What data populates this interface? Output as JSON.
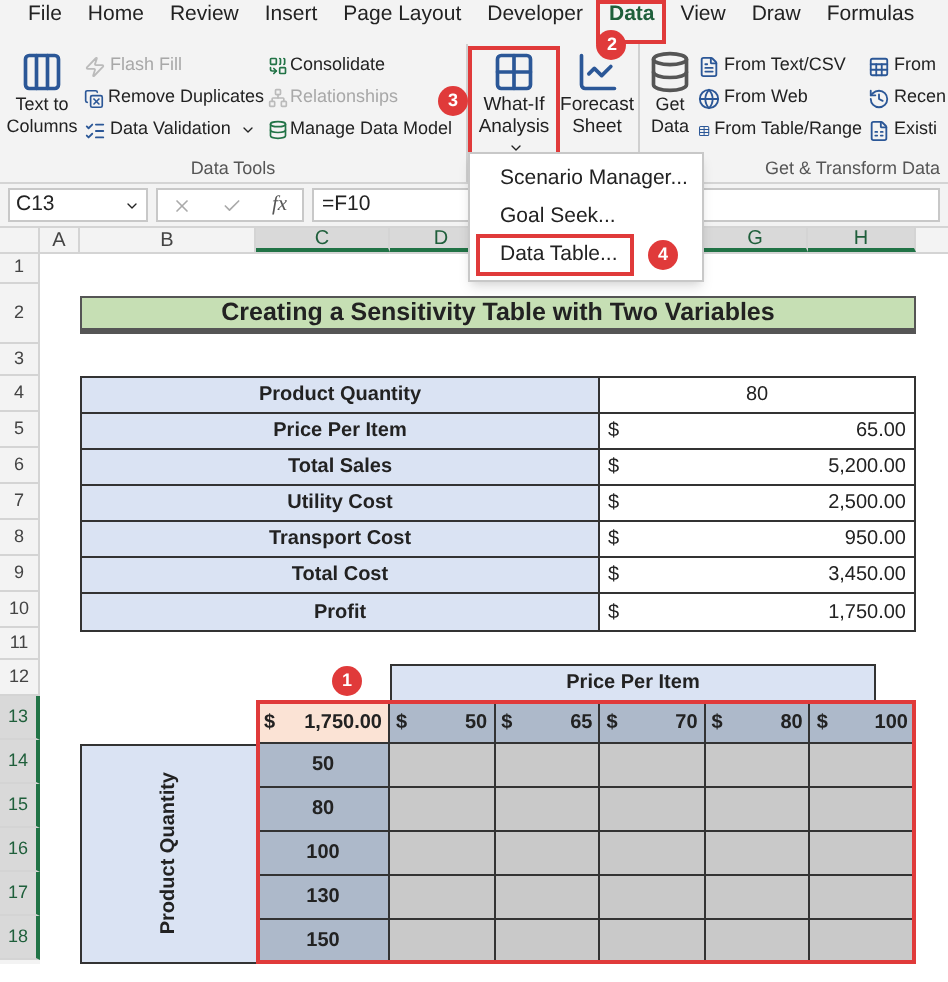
{
  "ribbon_tabs": [
    {
      "label": "File",
      "selected": false,
      "highlighted": false
    },
    {
      "label": "Home",
      "selected": false,
      "highlighted": false
    },
    {
      "label": "Review",
      "selected": false,
      "highlighted": false
    },
    {
      "label": "Insert",
      "selected": false,
      "highlighted": false
    },
    {
      "label": "Page Layout",
      "selected": false,
      "highlighted": false
    },
    {
      "label": "Developer",
      "selected": false,
      "highlighted": false
    },
    {
      "label": "Data",
      "selected": true,
      "highlighted": true,
      "badge": "2"
    },
    {
      "label": "View",
      "selected": false,
      "highlighted": false
    },
    {
      "label": "Draw",
      "selected": false,
      "highlighted": false
    },
    {
      "label": "Formulas",
      "selected": false,
      "highlighted": false
    }
  ],
  "data_tools_group": {
    "title": "Data Tools",
    "large_button": "Text to Columns",
    "commands_left": [
      {
        "label": "Flash Fill",
        "disabled": true,
        "dropdown": false
      },
      {
        "label": "Remove Duplicates",
        "disabled": false,
        "dropdown": false
      },
      {
        "label": "Data Validation",
        "disabled": false,
        "dropdown": true
      }
    ],
    "commands_right": [
      {
        "label": "Consolidate",
        "disabled": false
      },
      {
        "label": "Relationships",
        "disabled": true
      },
      {
        "label": "Manage Data Model",
        "disabled": false
      }
    ]
  },
  "forecast_group": {
    "what_if_button": {
      "label": "What-If Analysis",
      "highlighted": true,
      "badge": "3"
    },
    "forecast_button": "Forecast Sheet"
  },
  "get_transform_group": {
    "title": "Get & Transform Data",
    "get_data": "Get Data",
    "commands_1": [
      "From Text/CSV",
      "From Web",
      "From Table/Range"
    ],
    "commands_2": [
      "From",
      "Recen",
      "Existi"
    ]
  },
  "dropdown_menu": {
    "items": [
      {
        "label": "Scenario Manager...",
        "highlighted": false
      },
      {
        "label": "Goal Seek...",
        "highlighted": false
      },
      {
        "label": "Data Table...",
        "highlighted": true,
        "badge": "4"
      }
    ]
  },
  "formula_bar": {
    "name_box": "C13",
    "function_label": "fx",
    "formula": "=F10"
  },
  "column_headers": [
    {
      "label": "A",
      "selected": false
    },
    {
      "label": "B",
      "selected": false
    },
    {
      "label": "C",
      "selected": true
    },
    {
      "label": "D",
      "selected": true
    },
    {
      "label": "G",
      "selected": true
    },
    {
      "label": "H",
      "selected": true
    }
  ],
  "row_headers": [
    {
      "label": "1",
      "selected": false
    },
    {
      "label": "2",
      "selected": false
    },
    {
      "label": "3",
      "selected": false
    },
    {
      "label": "4",
      "selected": false
    },
    {
      "label": "5",
      "selected": false
    },
    {
      "label": "6",
      "selected": false
    },
    {
      "label": "7",
      "selected": false
    },
    {
      "label": "8",
      "selected": false
    },
    {
      "label": "9",
      "selected": false
    },
    {
      "label": "10",
      "selected": false
    },
    {
      "label": "11",
      "selected": false
    },
    {
      "label": "12",
      "selected": false
    },
    {
      "label": "13",
      "selected": true
    },
    {
      "label": "14",
      "selected": true
    },
    {
      "label": "15",
      "selected": true
    },
    {
      "label": "16",
      "selected": true
    },
    {
      "label": "17",
      "selected": true
    },
    {
      "label": "18",
      "selected": true
    }
  ],
  "title": "Creating a Sensitivity Table with Two Variables",
  "summary_table": [
    {
      "label": "Product Quantity",
      "kind": "plain",
      "value": "80"
    },
    {
      "label": "Price Per Item",
      "kind": "currency",
      "currency": "$",
      "value": "65.00"
    },
    {
      "label": "Total Sales",
      "kind": "currency",
      "currency": "$",
      "value": "5,200.00"
    },
    {
      "label": "Utility Cost",
      "kind": "currency",
      "currency": "$",
      "value": "2,500.00"
    },
    {
      "label": "Transport Cost",
      "kind": "currency",
      "currency": "$",
      "value": "950.00"
    },
    {
      "label": "Total Cost",
      "kind": "currency",
      "currency": "$",
      "value": "3,450.00"
    },
    {
      "label": "Profit",
      "kind": "currency",
      "currency": "$",
      "value": "1,750.00"
    }
  ],
  "sensitivity_table": {
    "header": "Price Per Item",
    "badge": "1",
    "highlighted": true,
    "corner": {
      "currency": "$",
      "value": "1,750.00"
    },
    "prices": [
      {
        "currency": "$",
        "value": "50"
      },
      {
        "currency": "$",
        "value": "65"
      },
      {
        "currency": "$",
        "value": "70"
      },
      {
        "currency": "$",
        "value": "80"
      },
      {
        "currency": "$",
        "value": "100"
      }
    ],
    "side_label": "Product Quantity",
    "quantities": [
      "50",
      "80",
      "100",
      "130",
      "150"
    ]
  }
}
